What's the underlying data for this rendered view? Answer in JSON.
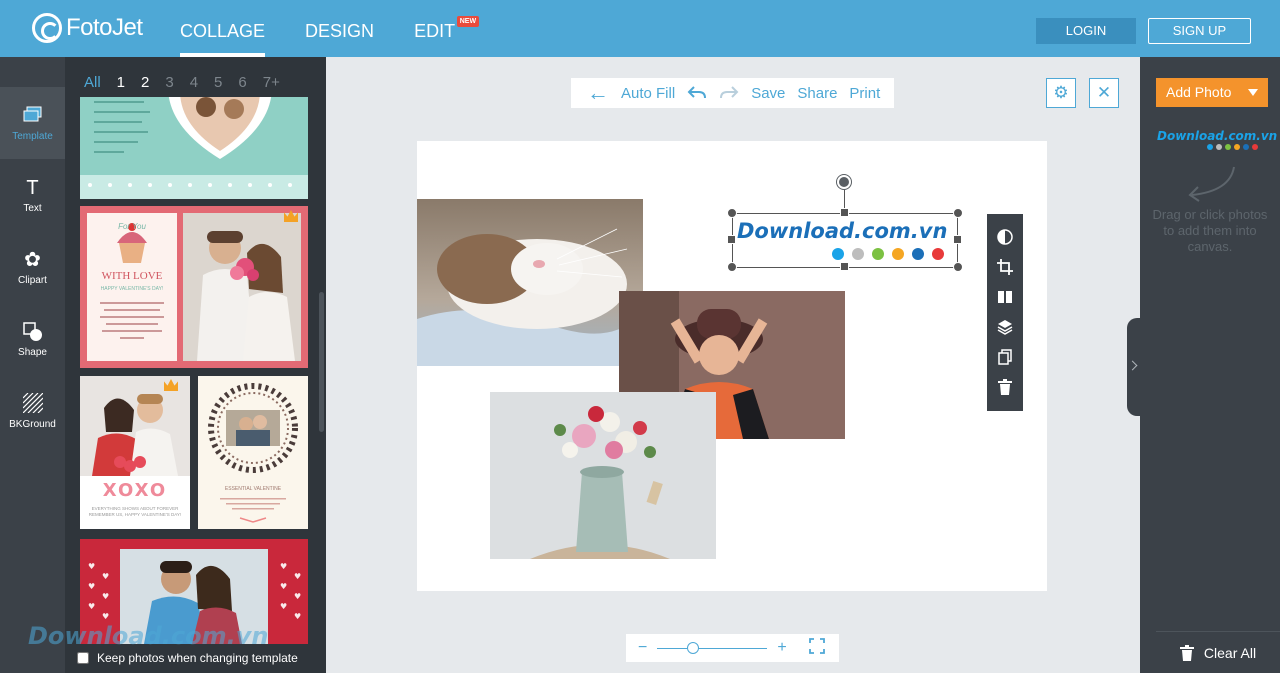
{
  "header": {
    "logo_text": "FotoJet",
    "tabs": [
      {
        "label": "COLLAGE",
        "active": true
      },
      {
        "label": "DESIGN",
        "active": false
      },
      {
        "label": "EDIT",
        "active": false,
        "badge": "NEW"
      }
    ],
    "login_label": "LOGIN",
    "signup_label": "SIGN UP"
  },
  "rail": {
    "items": [
      {
        "label": "Template",
        "icon": "layers-icon",
        "active": true
      },
      {
        "label": "Text",
        "icon": "text-icon"
      },
      {
        "label": "Clipart",
        "icon": "flower-icon"
      },
      {
        "label": "Shape",
        "icon": "shape-icon"
      },
      {
        "label": "BKGround",
        "icon": "hatch-icon"
      }
    ]
  },
  "templates": {
    "filters": [
      "All",
      "1",
      "2",
      "3",
      "4",
      "5",
      "6",
      "7+"
    ],
    "selected_filters": [
      "1",
      "2"
    ],
    "thumb_texts": {
      "cupcake_heading": "WITH LOVE",
      "cupcake_sub": "HAPPY VALENTINE'S DAY!",
      "for_you": "For You",
      "xoxo": "XOXO",
      "xoxo_caption": "EVERYTHING SHOWS ABOUT FOREVER REMEMBER US, HAPPY VALENTINE'S DAY!",
      "essential": "ESSENTIAL VALENTINE"
    },
    "keep_photos_label": "Keep photos when changing template",
    "keep_photos_checked": false
  },
  "toolbar": {
    "autofill_label": "Auto Fill",
    "save_label": "Save",
    "share_label": "Share",
    "print_label": "Print"
  },
  "canvas": {
    "watermark_text": "Download.com.vn",
    "watermark_dots": [
      "#1aa3e8",
      "#bdbdbd",
      "#7cc142",
      "#f5a623",
      "#1b6fb8",
      "#e83a3a"
    ],
    "photos": [
      "cat",
      "woman-in-hat",
      "flowers-in-pitcher"
    ]
  },
  "right_panel": {
    "add_photo_label": "Add Photo",
    "brand_text": "Download.com.vn",
    "drag_hint": "Drag or click photos to add them into canvas.",
    "clear_all_label": "Clear All"
  },
  "footer_watermark": "Download.com.vn"
}
